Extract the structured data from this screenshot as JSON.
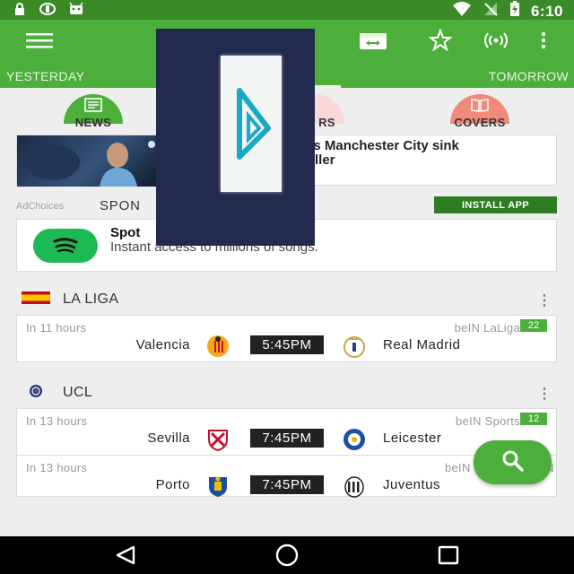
{
  "status_bar": {
    "time": "6:10",
    "icons": [
      "lock-icon",
      "sync-icon",
      "android-icon",
      "wifi-icon",
      "no-signal-icon",
      "battery-charging-icon"
    ]
  },
  "toolbar": {
    "icons": [
      "menu-icon",
      "calendar-icon",
      "star-icon",
      "broadcast-icon",
      "more-vert-icon"
    ],
    "tabs": {
      "left": "YESTERDAY",
      "right": "TOMORROW"
    }
  },
  "categories": [
    {
      "label": "NEWS",
      "icon": "newspaper-icon",
      "color": "#4caf3b"
    },
    {
      "label": "RS",
      "icon": "",
      "color": "#f8d8d8"
    },
    {
      "label": "COVERS",
      "icon": "book-icon",
      "color": "#f08a7a"
    }
  ],
  "news": {
    "title_line1": "as Manchester City sink",
    "title_line2": "riller"
  },
  "ad": {
    "adchoices": "AdChoices",
    "sponsored": "SPON",
    "install_label": "INSTALL APP",
    "title": "Spot",
    "subtitle": "Instant access to millions of songs.",
    "brand_color": "#1db954"
  },
  "leagues": [
    {
      "name": "LA LIGA",
      "flag": "spain-flag-icon",
      "matches": [
        {
          "when": "In 11 hours",
          "channel": "beIN LaLiga",
          "count": "22",
          "home": "Valencia",
          "time": "5:45PM",
          "away": "Real Madrid"
        }
      ]
    },
    {
      "name": "UCL",
      "flag": "ucl-logo-icon",
      "matches": [
        {
          "when": "In 13 hours",
          "channel": "beIN Sports",
          "count": "12",
          "home": "Sevilla",
          "time": "7:45PM",
          "away": "Leicester"
        },
        {
          "when": "In 13 hours",
          "channel": "beIN Sports, beIN N",
          "count": "",
          "home": "Porto",
          "time": "7:45PM",
          "away": "Juventus"
        }
      ]
    }
  ],
  "colors": {
    "primary": "#4caf3b",
    "status": "#3a8a28",
    "accent_dark": "#2e7d22",
    "overlay": "#222a4d"
  }
}
